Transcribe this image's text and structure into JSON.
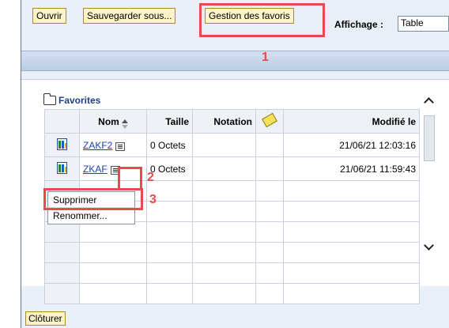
{
  "toolbar": {
    "open_label": "Ouvrir",
    "save_as_label": "Sauvegarder sous...",
    "manage_favorites_label": "Gestion des favoris",
    "display_label": "Affichage :",
    "display_value": "Table"
  },
  "annotations": {
    "step1": "1",
    "step2": "2",
    "step3": "3"
  },
  "folder": {
    "name": "Favorites"
  },
  "table": {
    "columns": {
      "name": "Nom",
      "size": "Taille",
      "rating": "Notation",
      "modified": "Modifié le"
    },
    "rows": [
      {
        "name": "ZAKF2",
        "size": "0 Octets",
        "rating": "",
        "modified": "21/06/21 12:03:16"
      },
      {
        "name": "ZKAF",
        "size": "0 Octets",
        "rating": "",
        "modified": "21/06/21 11:59:43"
      }
    ]
  },
  "context_menu": {
    "delete_label": "Supprimer",
    "rename_label": "Renommer..."
  },
  "footer": {
    "close_label": "Clôturer"
  },
  "colors": {
    "annotation_red": "#e84a50",
    "button_bg": "#fdf3c9",
    "link_blue": "#1a3fb8",
    "folder_title": "#1c3f8c"
  }
}
